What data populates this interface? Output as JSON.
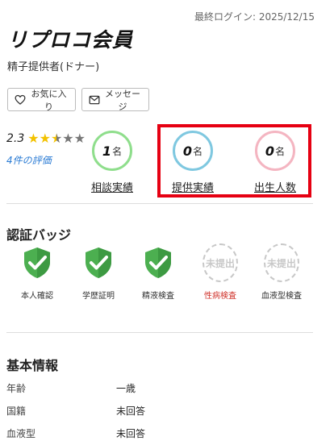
{
  "last_login": "最終ログイン: 2025/12/15",
  "profile": {
    "name": "リプロコ会員",
    "role": "精子提供者(ドナー)"
  },
  "actions": {
    "favorite_label": "お気に入り",
    "message_label": "メッセージ"
  },
  "rating": {
    "score": "2.3",
    "stars_value": 2.5,
    "stars_max": 5,
    "reviews_link": "4件の評価"
  },
  "stats": [
    {
      "value": "1",
      "unit": "名",
      "label": "相談実績",
      "ring_color": "#8fde8c"
    },
    {
      "value": "0",
      "unit": "名",
      "label": "提供実績",
      "ring_color": "#7fc8e0"
    },
    {
      "value": "0",
      "unit": "名",
      "label": "出生人数",
      "ring_color": "#f4b5c1"
    }
  ],
  "highlight_color": "#e60012",
  "badges_section": {
    "title": "認証バッジ",
    "items": [
      {
        "label": "本人確認",
        "status": "verified",
        "icon": "shield-check-icon"
      },
      {
        "label": "学歴証明",
        "status": "verified",
        "icon": "shield-check-icon"
      },
      {
        "label": "精液検査",
        "status": "verified",
        "icon": "shield-check-icon"
      },
      {
        "label": "性病検査",
        "status": "unsubmitted",
        "icon_text": "未提出",
        "label_color": "#d0342c"
      },
      {
        "label": "血液型検査",
        "status": "unsubmitted",
        "icon_text": "未提出"
      }
    ]
  },
  "info_section": {
    "title": "基本情報",
    "rows": [
      {
        "key": "年齢",
        "value": "一歳"
      },
      {
        "key": "国籍",
        "value": "未回答"
      },
      {
        "key": "血液型",
        "value": "未回答"
      }
    ]
  }
}
